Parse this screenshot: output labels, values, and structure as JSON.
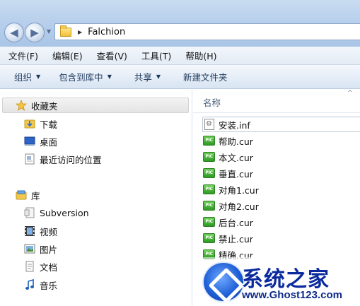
{
  "window": {
    "address": {
      "crumb": "Falchion"
    }
  },
  "menu": [
    "文件(F)",
    "编辑(E)",
    "查看(V)",
    "工具(T)",
    "帮助(H)"
  ],
  "commands": [
    {
      "label": "组织",
      "has_dropdown": true
    },
    {
      "label": "包含到库中",
      "has_dropdown": true
    },
    {
      "label": "共享",
      "has_dropdown": true
    },
    {
      "label": "新建文件夹",
      "has_dropdown": false
    }
  ],
  "nav": {
    "favorites": {
      "label": "收藏夹",
      "items": [
        "下载",
        "桌面",
        "最近访问的位置"
      ]
    },
    "libraries": {
      "label": "库",
      "items": [
        "Subversion",
        "视频",
        "图片",
        "文档",
        "音乐"
      ]
    }
  },
  "files": {
    "column_header": "名称",
    "items": [
      {
        "name": "安装.inf",
        "icon": "inf-file-icon"
      },
      {
        "name": "帮助.cur",
        "icon": "cursor-file-icon"
      },
      {
        "name": "本文.cur",
        "icon": "cursor-file-icon"
      },
      {
        "name": "垂直.cur",
        "icon": "cursor-file-icon"
      },
      {
        "name": "对角1.cur",
        "icon": "cursor-file-icon"
      },
      {
        "name": "对角2.cur",
        "icon": "cursor-file-icon"
      },
      {
        "name": "后台.cur",
        "icon": "cursor-file-icon"
      },
      {
        "name": "禁止.cur",
        "icon": "cursor-file-icon"
      },
      {
        "name": "精确.cur",
        "icon": "cursor-file-icon"
      }
    ],
    "pic_label": "PIC"
  },
  "watermark": {
    "title": "系统之家",
    "url": "www.Ghost123.com"
  }
}
